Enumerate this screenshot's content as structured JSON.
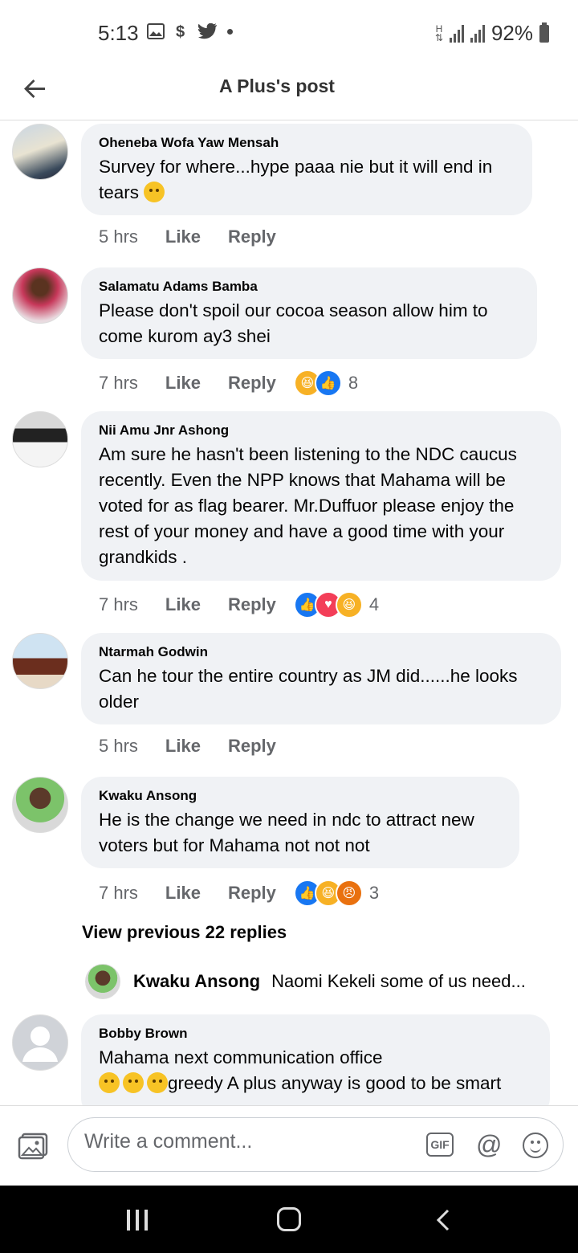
{
  "status_bar": {
    "time": "5:13",
    "battery": "92%"
  },
  "header": {
    "title": "A Plus's post"
  },
  "comments": [
    {
      "author": "Oheneba Wofa Yaw Mensah",
      "text": "Survey for where...hype paaa nie but it will end in tears",
      "time": "5 hrs",
      "like": "Like",
      "reply": "Reply",
      "reaction_count": ""
    },
    {
      "author": "Salamatu Adams Bamba",
      "text": "Please don't spoil our cocoa season allow him to come kurom ay3 shei",
      "time": "7 hrs",
      "like": "Like",
      "reply": "Reply",
      "reaction_count": "8"
    },
    {
      "author": "Nii Amu Jnr Ashong",
      "text": "Am sure he hasn't been listening to the NDC caucus recently. Even the NPP knows that Mahama will be voted for as flag bearer. Mr.Duffuor  please enjoy the rest of your money and have a good time with your grandkids .",
      "time": "7 hrs",
      "like": "Like",
      "reply": "Reply",
      "reaction_count": "4"
    },
    {
      "author": "Ntarmah Godwin",
      "text": "Can he tour the entire country as JM did......he looks older",
      "time": "5 hrs",
      "like": "Like",
      "reply": "Reply",
      "reaction_count": ""
    },
    {
      "author": "Kwaku Ansong",
      "text": "He is the change we need in ndc to attract new voters but for Mahama not not not",
      "time": "7 hrs",
      "like": "Like",
      "reply": "Reply",
      "reaction_count": "3"
    },
    {
      "author": "Bobby Brown",
      "text": "Mahama next communication office",
      "text2": "greedy A plus anyway is good to be smart"
    }
  ],
  "replies": {
    "view_previous": "View previous 22 replies",
    "preview_author": "Kwaku Ansong",
    "preview_text": "Naomi Kekeli some of us need..."
  },
  "composer": {
    "placeholder": "Write a comment...",
    "gif_label": "GIF",
    "mention_label": "@"
  },
  "icons": [
    "gallery-icon",
    "dollar-icon",
    "twitter-icon",
    "signal-icon",
    "battery-icon",
    "back-arrow-icon",
    "photo-icon",
    "gif-icon",
    "mention-icon",
    "emoji-icon"
  ],
  "colors": {
    "accent": "#1877f2",
    "bubble": "#f0f2f5",
    "meta": "#65676b"
  }
}
